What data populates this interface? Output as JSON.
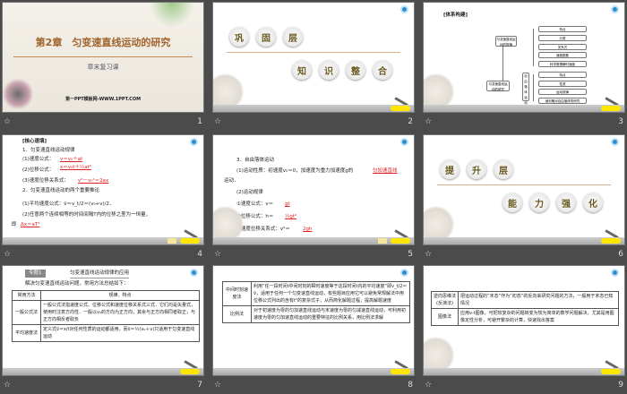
{
  "slides": [
    {
      "number": "1",
      "title": "第2章　匀变速直线运动的研究",
      "subtitle": "章末复习课",
      "footer_site": "第一PPT模板网-WWW.1PPT.COM"
    },
    {
      "number": "2",
      "row1": [
        "巩",
        "固",
        "层"
      ],
      "row2": [
        "知",
        "识",
        "整",
        "合"
      ]
    },
    {
      "number": "3",
      "heading": "[体系构建]",
      "root": "匀变速直线运动的研究",
      "branch1": "匀变速直线运动的规律",
      "branch1_items": [
        "特点",
        "分类",
        "关系式",
        "速度图象",
        "科学推理瞬时速度"
      ],
      "branch2": "自由落体运动",
      "branch2_items": [
        "特点",
        "性质",
        "运动规律",
        "伽利略对自由落体的研究"
      ]
    },
    {
      "number": "4",
      "heading": "[核心速填]",
      "lines": [
        "1．匀变速直线运动规律",
        "(1)速度公式：",
        "(2)位移公式：",
        "(3)速度位移关系式：",
        "2．匀变速直线运动的两个重要推论",
        "(1)平均速度公式：v̄＝v_t/2＝(v₀+v)/2．",
        "(2)任意两个连续相等的时间间隔T内的位移之差为一恒量，",
        "即"
      ],
      "answers": [
        "v＝v₀＋at",
        "x＝v₀t＋½at²",
        "v²－v₀²＝2ax",
        "Δx＝aT²"
      ]
    },
    {
      "number": "5",
      "lines": [
        "3．自由落体运动",
        "(1)运动性质：初速度v₀＝0，加速度为重力加速度g的",
        "运动．",
        "(2)运动规律",
        "①速度公式：v＝",
        "②位移公式：h＝",
        "③速度位移关系式：v²＝"
      ],
      "answers": [
        "匀加速直线",
        "gt",
        "½gt²",
        "2gh"
      ]
    },
    {
      "number": "6",
      "row1": [
        "提",
        "升",
        "层"
      ],
      "row2": [
        "能",
        "力",
        "强",
        "化"
      ]
    },
    {
      "number": "7",
      "badge": "专题1",
      "title": "匀变速直线运动规律的应用",
      "intro": "解决匀变速直线运动问题，常用方法总结如下：",
      "headers": [
        "常用方法",
        "规律、特点"
      ],
      "rows": [
        [
          "一般公式法",
          "一般公式法指速度公式、位移公式和速度位移关系式三式．它们均是矢量式，使用时注意方向性．一般以v₀的方向为正方向，其余与正方向相同者取正，与正方向相反者取负"
        ],
        [
          "平均速度法",
          "定义式v̄＝x/t对任何性质的运动都适用，而v̄＝½(v₀＋v)只适用于匀变速直线运动"
        ]
      ]
    },
    {
      "number": "8",
      "rows": [
        [
          "中间时刻速度法",
          "利用“任一段时间t中间时刻的瞬时速度等于这段时间t内的平均速度”即v_t/2＝v̄，适用于任何一个匀变速直线运动，有些题目应用它可以避免常规解法中用位移公式列出的含有t²的复杂式子，从而简化解题过程，提高解题速度"
        ],
        [
          "比例法",
          "对于初速度为零的匀加速直线运动与末速度为零的匀减速直线运动，可利用初速度为零的匀加速直线运动的重要特征的比例关系，用比例法求解"
        ]
      ]
    },
    {
      "number": "9",
      "rows": [
        [
          "逆向思维法(反演法)",
          "把运动过程的“末态”作为“初态”的反向来研究问题的方法，一般用于末态已知情况"
        ],
        [
          "图像法",
          "应用v-t图像，可把较复杂的问题转变为较为简单的数学问题解决，尤其是用图像定性分析，可避开繁杂的计算，快速找出答案"
        ]
      ]
    }
  ],
  "footer_icon": "transition-star-icon",
  "colors": {
    "background": "#4b4b4b",
    "answer": "#e02020",
    "title": "#a0622a"
  }
}
